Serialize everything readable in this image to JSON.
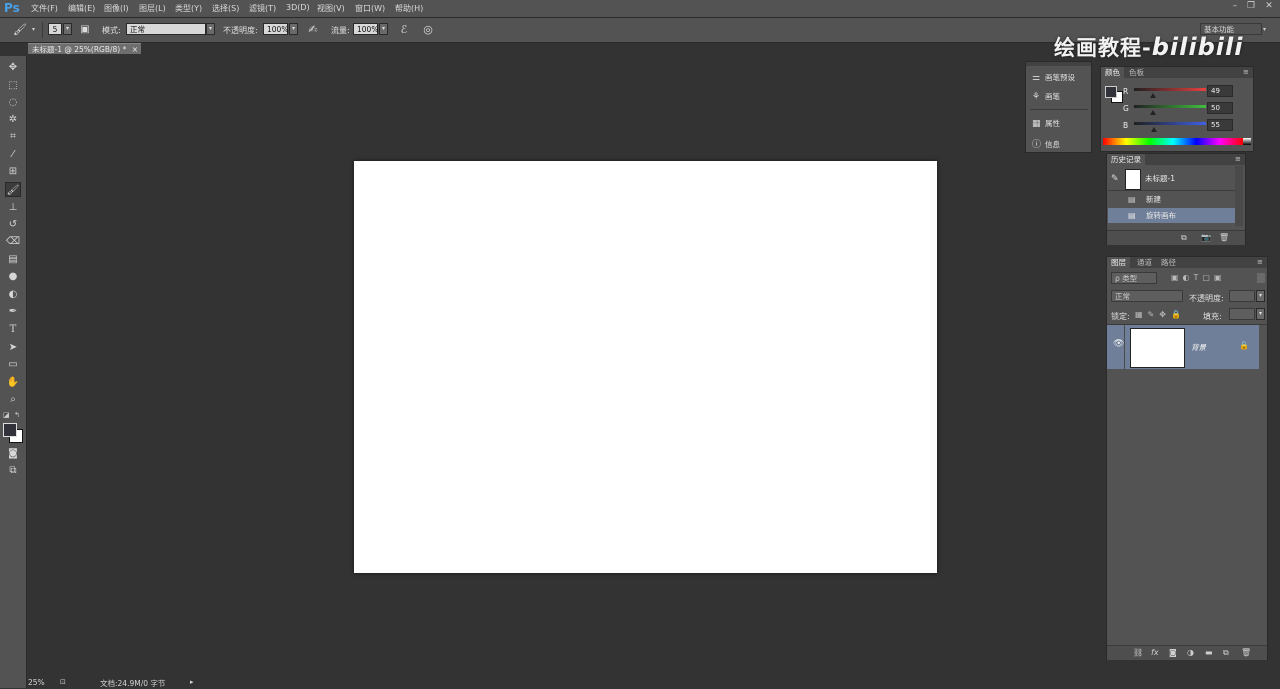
{
  "app": {
    "logo": "Ps"
  },
  "menu": [
    "文件(F)",
    "编辑(E)",
    "图像(I)",
    "图层(L)",
    "类型(Y)",
    "选择(S)",
    "滤镜(T)",
    "3D(D)",
    "视图(V)",
    "窗口(W)",
    "帮助(H)"
  ],
  "options": {
    "brush_size": "5",
    "mode_label": "模式:",
    "mode_value": "正常",
    "opacity_label": "不透明度:",
    "opacity_value": "100%",
    "flow_label": "流量:",
    "flow_value": "100%",
    "workspace": "基本功能"
  },
  "document": {
    "tab_title": "未标题-1 @ 25%(RGB/8) *",
    "close": "×"
  },
  "watermark": {
    "text": "绘画教程-",
    "brand": "bilibili"
  },
  "dock": [
    {
      "icon": "brush-presets-icon",
      "label": "画笔预设"
    },
    {
      "icon": "brush-icon",
      "label": "画笔"
    },
    {
      "icon": "properties-icon",
      "label": "属性"
    },
    {
      "icon": "info-icon",
      "label": "信息"
    }
  ],
  "color_panel": {
    "tabs": [
      "颜色",
      "色板"
    ],
    "channels": [
      {
        "label": "R",
        "value": "49",
        "color": "#e84040"
      },
      {
        "label": "G",
        "value": "50",
        "color": "#40c040"
      },
      {
        "label": "B",
        "value": "55",
        "color": "#4060e8"
      }
    ]
  },
  "history_panel": {
    "tab": "历史记录",
    "snapshot": "未标题-1",
    "items": [
      {
        "label": "新建",
        "selected": false
      },
      {
        "label": "旋转画布",
        "selected": true
      }
    ]
  },
  "layers_panel": {
    "tabs": [
      "图层",
      "通道",
      "路径"
    ],
    "filter_label": "ρ 类型",
    "blend_mode": "正常",
    "opacity_label": "不透明度:",
    "lock_label": "锁定:",
    "fill_label": "填充:",
    "layers": [
      {
        "name": "背景",
        "locked": true,
        "visible": true
      }
    ]
  },
  "status": {
    "zoom": "25%",
    "doc_info": "文档:24.9M/0 字节"
  },
  "colors": {
    "selection": "#6f7f99",
    "canvas": "#ffffff",
    "workspace_bg": "#333333"
  }
}
